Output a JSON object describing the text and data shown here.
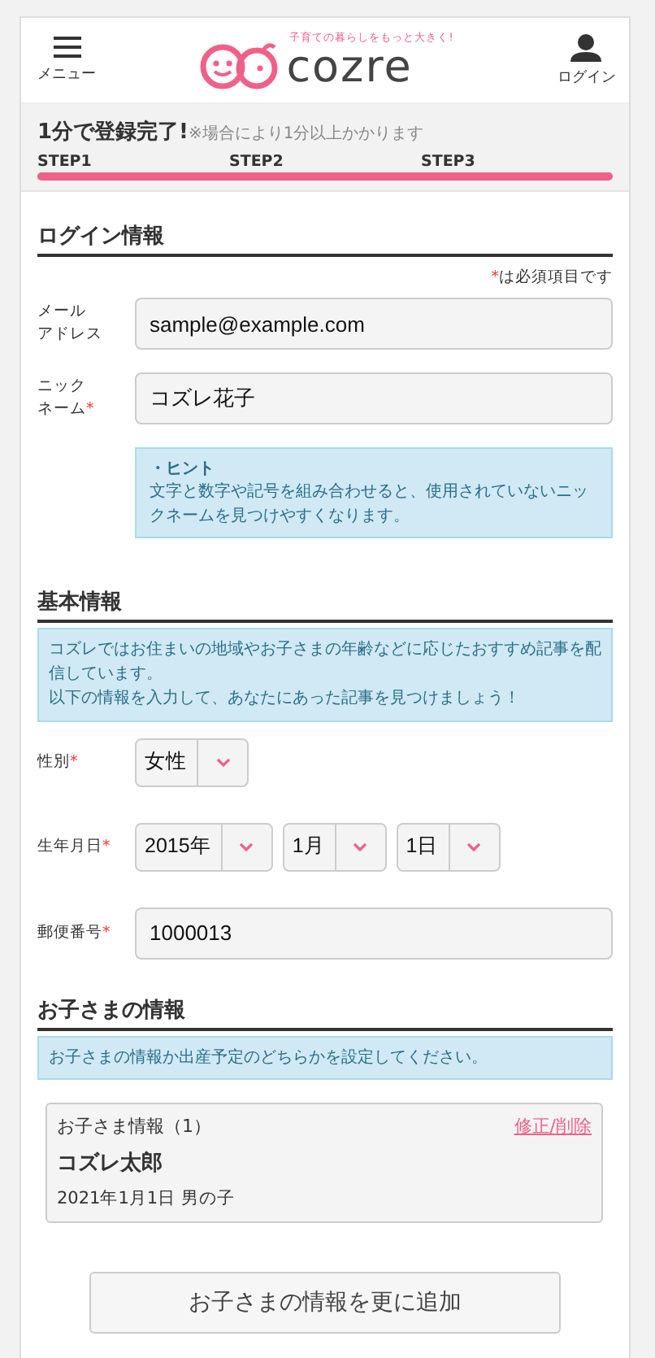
{
  "required_mark": "*",
  "header": {
    "menu_label": "メニュー",
    "logo_text": "cozre",
    "tagline": "子育ての暮らしをもっと大きく!",
    "login_label": "ログイン"
  },
  "progress": {
    "title": "1分で登録完了!",
    "note": "※場合により1分以上かかります",
    "steps": [
      "STEP1",
      "STEP2",
      "STEP3"
    ],
    "level": 1
  },
  "login_section": {
    "heading": "ログイン情報",
    "required_note": "は必須項目です",
    "fields": [
      {
        "label": [
          "メール",
          "アドレス"
        ],
        "required": false,
        "value": "sample@example.com"
      },
      {
        "label": [
          "ニック",
          "ネーム"
        ],
        "required": true,
        "value": "コズレ花子"
      }
    ],
    "hint": {
      "title": "・ヒント",
      "text": "文字と数字や記号を組み合わせると、使用されていないニックネームを見つけやすくなります。"
    }
  },
  "basic_section": {
    "heading": "基本情報",
    "info": [
      "コズレではお住まいの地域やお子さまの年齢などに応じたおすすめ記事を配信しています。",
      "以下の情報を入力して、あなたにあった記事を見つけましょう！"
    ],
    "rows": [
      {
        "kind": "select",
        "label": [
          "性別"
        ],
        "required": true,
        "selects": [
          "女性"
        ]
      },
      {
        "kind": "select",
        "label": [
          "生年月日"
        ],
        "required": true,
        "selects": [
          "2015年",
          "1月",
          "1日"
        ]
      },
      {
        "kind": "input",
        "label": [
          "郵便番号"
        ],
        "required": true,
        "value": "1000013"
      }
    ]
  },
  "children_section": {
    "heading": "お子さまの情報",
    "info": "お子さまの情報か出産予定のどちらかを設定してください。",
    "children": [
      {
        "title": "お子さま情報（1）",
        "edit_link": "修正/削除",
        "name": "コズレ太郎",
        "details": "2021年1月1日 男の子"
      }
    ],
    "add_button": "お子さまの情報を更に追加"
  }
}
